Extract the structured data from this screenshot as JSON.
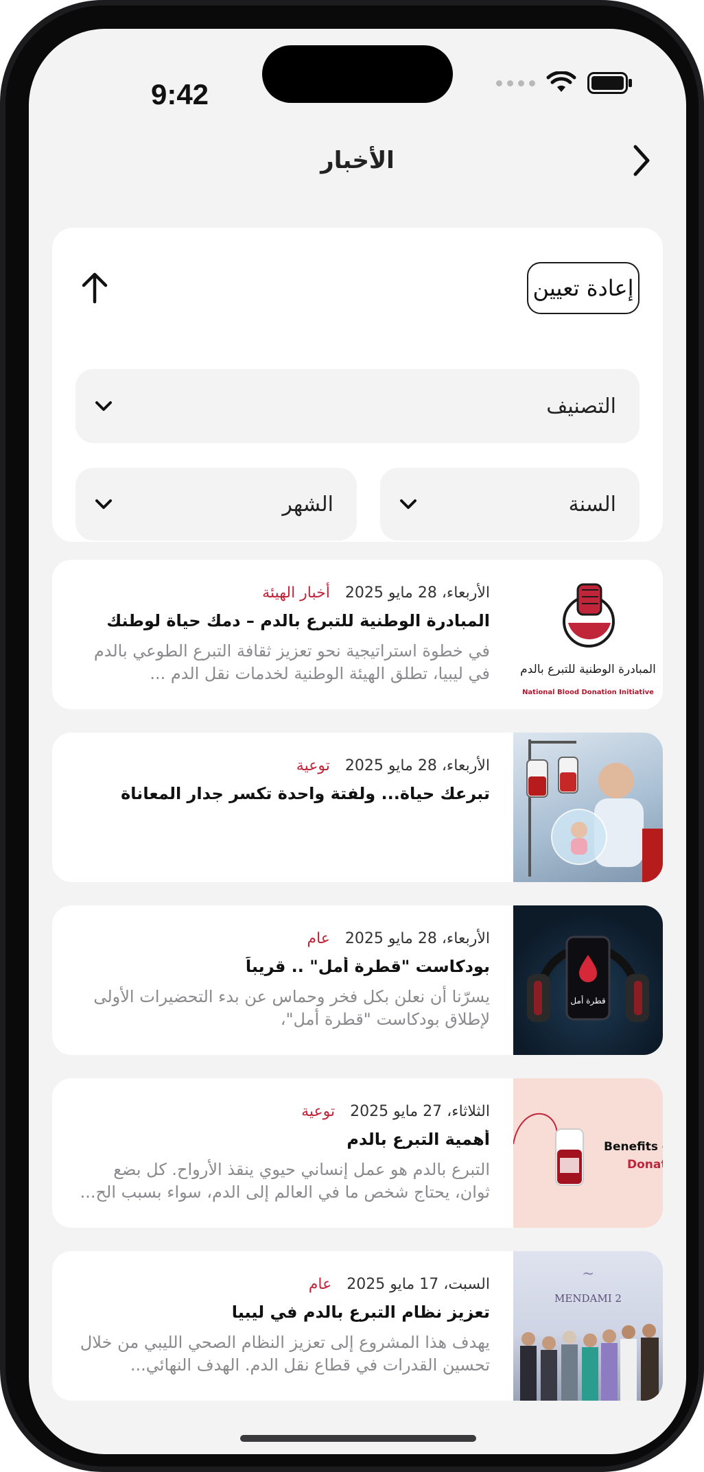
{
  "status_bar": {
    "time": "9:42"
  },
  "header": {
    "title": "الأخبار"
  },
  "filters": {
    "reset_label": "إعادة تعيين",
    "category_label": "التصنيف",
    "year_label": "السنة",
    "month_label": "الشهر"
  },
  "news": [
    {
      "date": "الأربعاء، 28 مايو 2025",
      "category": "أخبار الهيئة",
      "title": "المبادرة الوطنية للتبرع بالدم – دمك حياة لوطنك",
      "excerpt": "في خطوة استراتيجية نحو تعزيز ثقافة التبرع الطوعي بالدم في ليبيا، تطلق الهيئة الوطنية لخدمات نقل الدم ...",
      "logo_text": "المبادرة الوطنية للتبرع بالدم",
      "logo_caption": "National Blood Donation Initiative"
    },
    {
      "date": "الأربعاء، 28 مايو 2025",
      "category": "توعية",
      "title": "تبرعك حياة... ولفتة واحدة تكسر جدار المعاناة",
      "excerpt": ""
    },
    {
      "date": "الأربعاء، 28 مايو 2025",
      "category": "عام",
      "title": "بودكاست \"قطرة أمل\" .. قريباً",
      "excerpt": "يسرّنا أن نعلن بكل فخر وحماس عن بدء التحضيرات الأولى لإطلاق بودكاست \"قطرة أمل\"،",
      "image_text": "قطرة أمل"
    },
    {
      "date": "الثلاثاء، 27 مايو 2025",
      "category": "توعية",
      "title": "أهمية التبرع بالدم",
      "excerpt": "التبرع بالدم هو عمل إنساني حيوي ينقذ الأرواح. كل بضع ثوان، يحتاج شخص ما في العالم إلى الدم، سواء بسبب الح...",
      "image_text_1": "Benefits o",
      "image_text_2": "Donat"
    },
    {
      "date": "السبت، 17 مايو 2025",
      "category": "عام",
      "title": "تعزيز نظام التبرع بالدم في ليبيا",
      "excerpt": "يهدف هذا المشروع إلى تعزيز النظام الصحي الليبي من خلال تحسين القدرات في قطاع نقل الدم. الهدف النهائي...",
      "image_text": "MENDAMI 2"
    }
  ]
}
